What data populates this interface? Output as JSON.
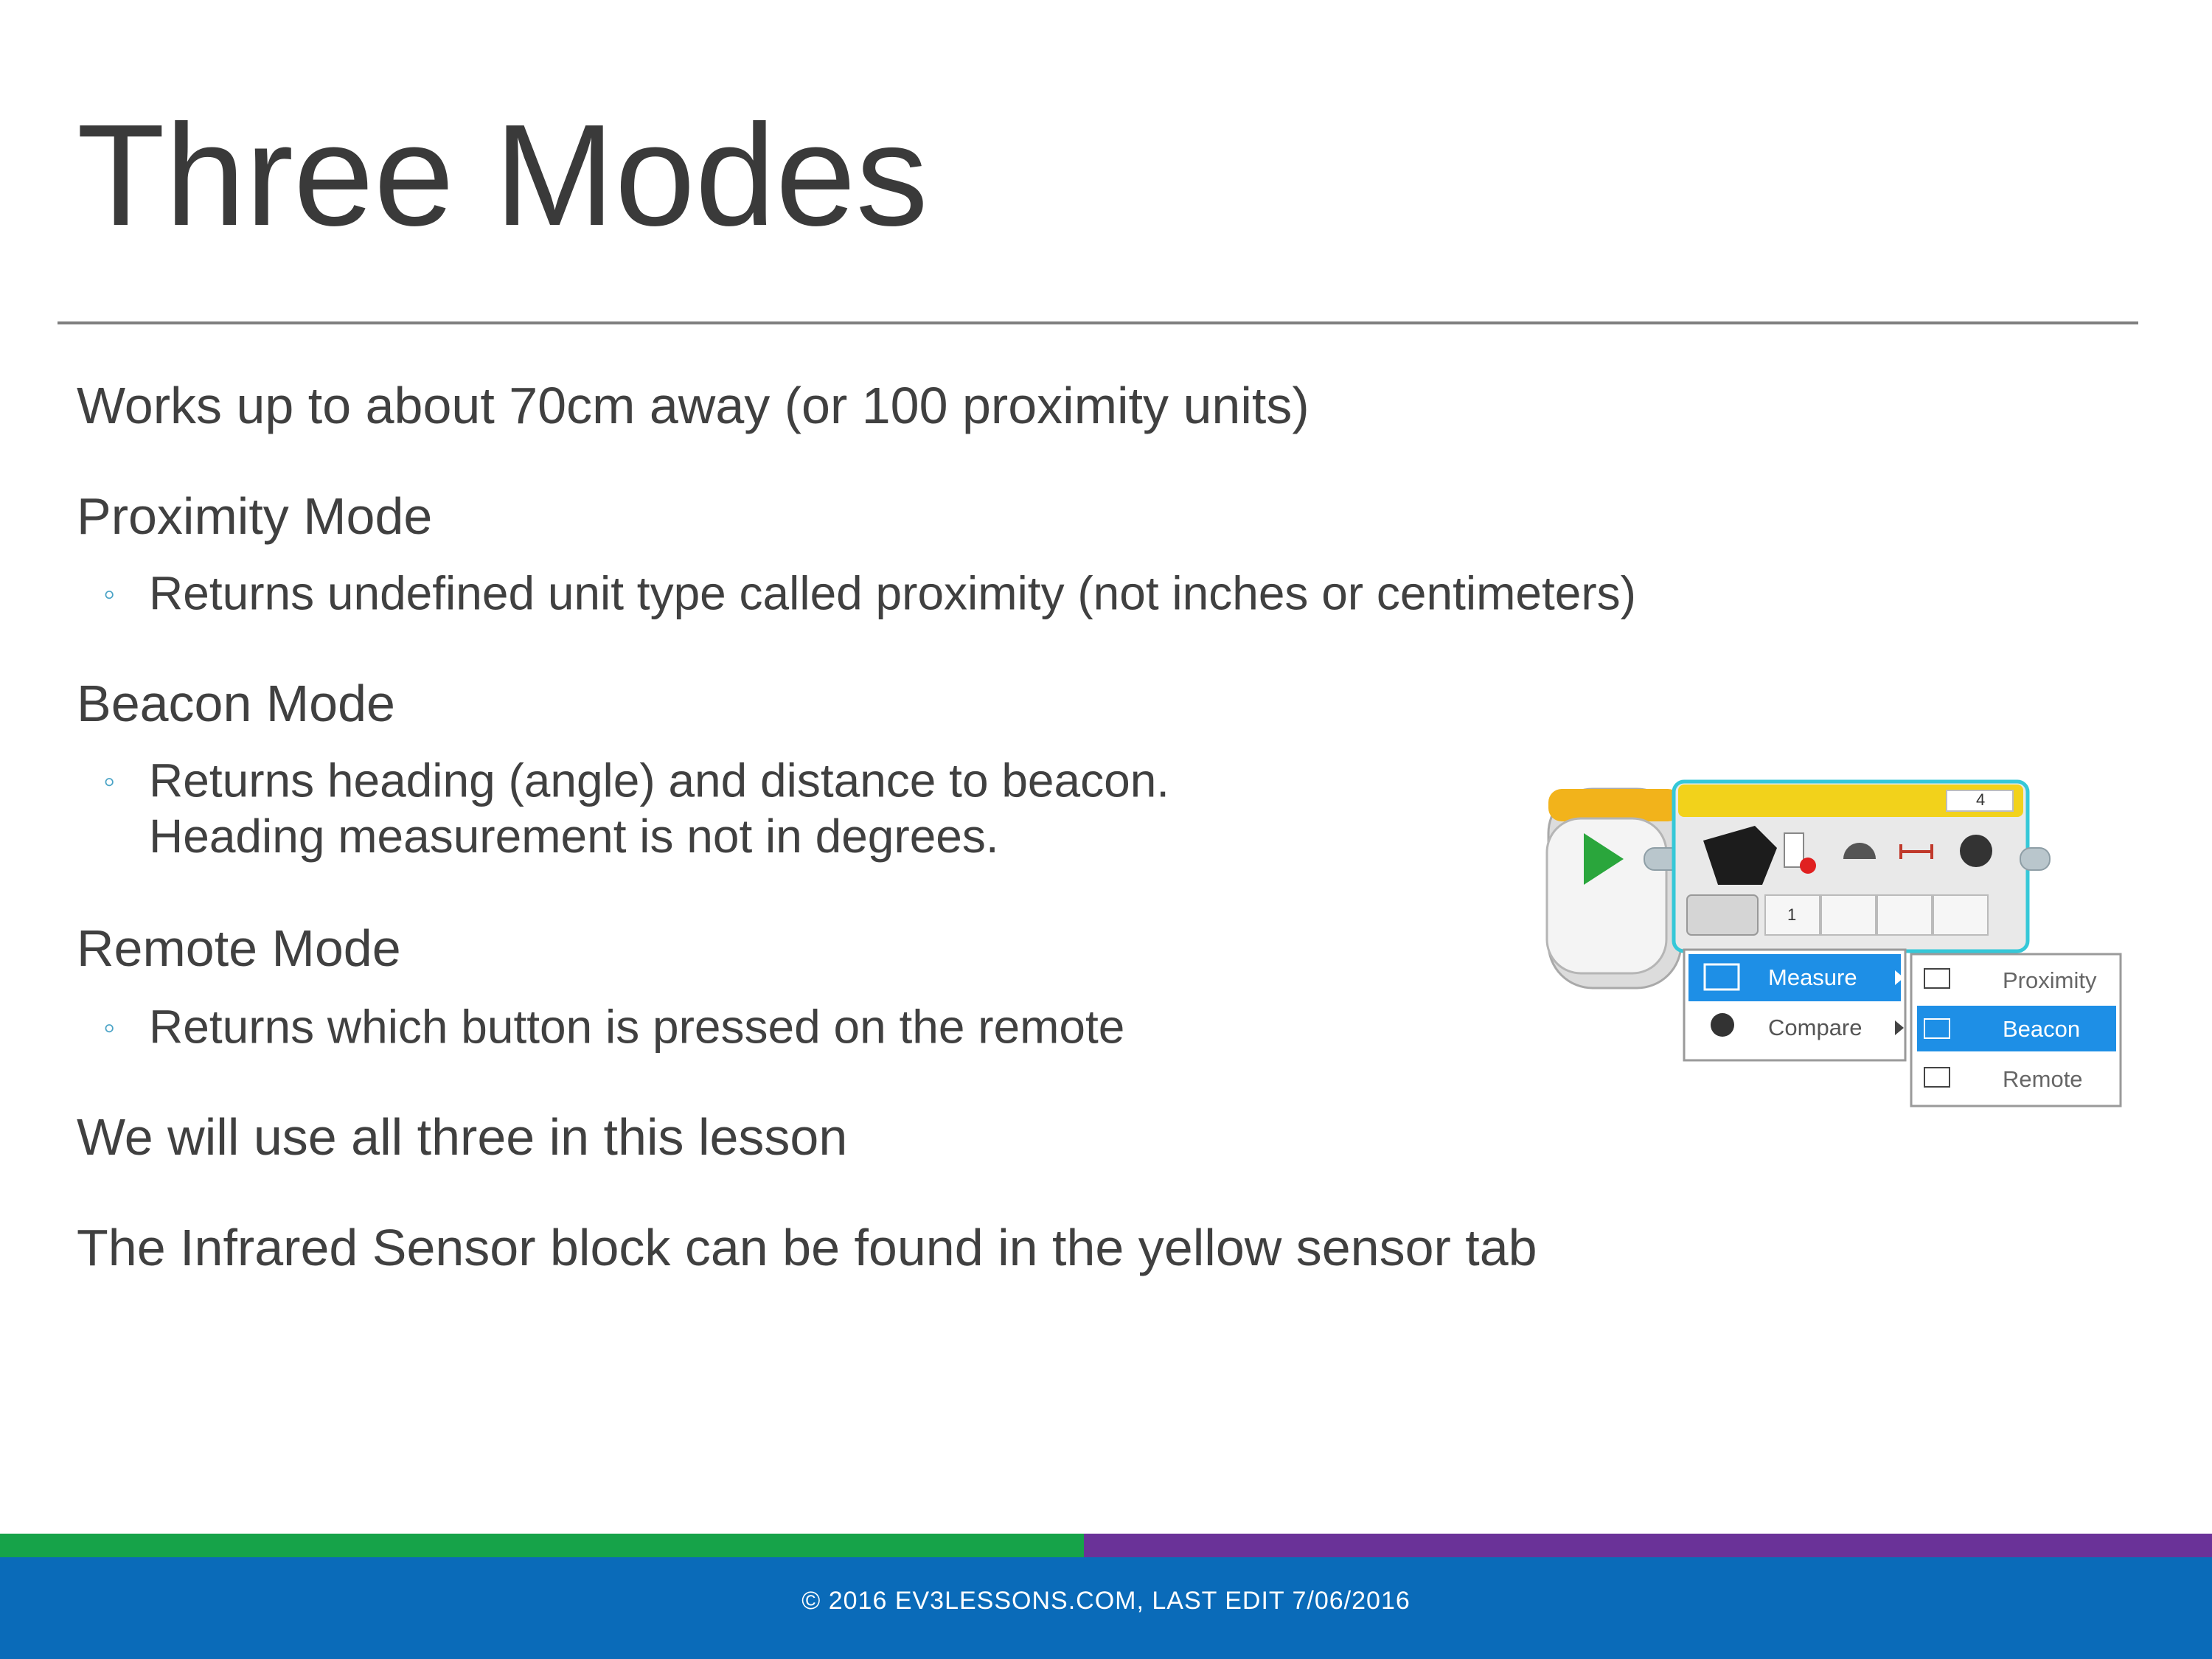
{
  "slide": {
    "title": "Three Modes",
    "line_range": "Works up to about 70cm away (or 100 proximity units)",
    "proximity_heading": "Proximity Mode",
    "proximity_bullet": "Returns undefined  unit type called proximity (not  inches or centimeters)",
    "beacon_heading": "Beacon Mode",
    "beacon_bullet_1": "Returns heading (angle) and distance to beacon.",
    "beacon_bullet_2": "Heading  measurement is not in degrees.",
    "remote_heading": "Remote Mode",
    "remote_bullet": "Returns which button is pressed on the remote",
    "line_use": "We will use all three in this lesson",
    "line_found": "The Infrared Sensor block can be found in the yellow sensor tab",
    "bullet_glyph": "◦"
  },
  "ev3_block": {
    "port_label": "4",
    "slot_value": "1",
    "menu_measure": "Measure",
    "menu_compare": "Compare",
    "submenu_proximity": "Proximity",
    "submenu_beacon": "Beacon",
    "submenu_remote": "Remote",
    "selected_mode": "Beacon",
    "colors": {
      "selection": "#1e8fe6",
      "block_header": "#f2d21b",
      "block_outline": "#35c8d8",
      "start_arrow": "#2aa63c"
    }
  },
  "footer": {
    "text": "© 2016 EV3LESSONS.COM, LAST EDIT 7/06/2016",
    "colors": {
      "green": "#16a349",
      "purple": "#6a3298",
      "blue": "#0a6bb9"
    }
  }
}
